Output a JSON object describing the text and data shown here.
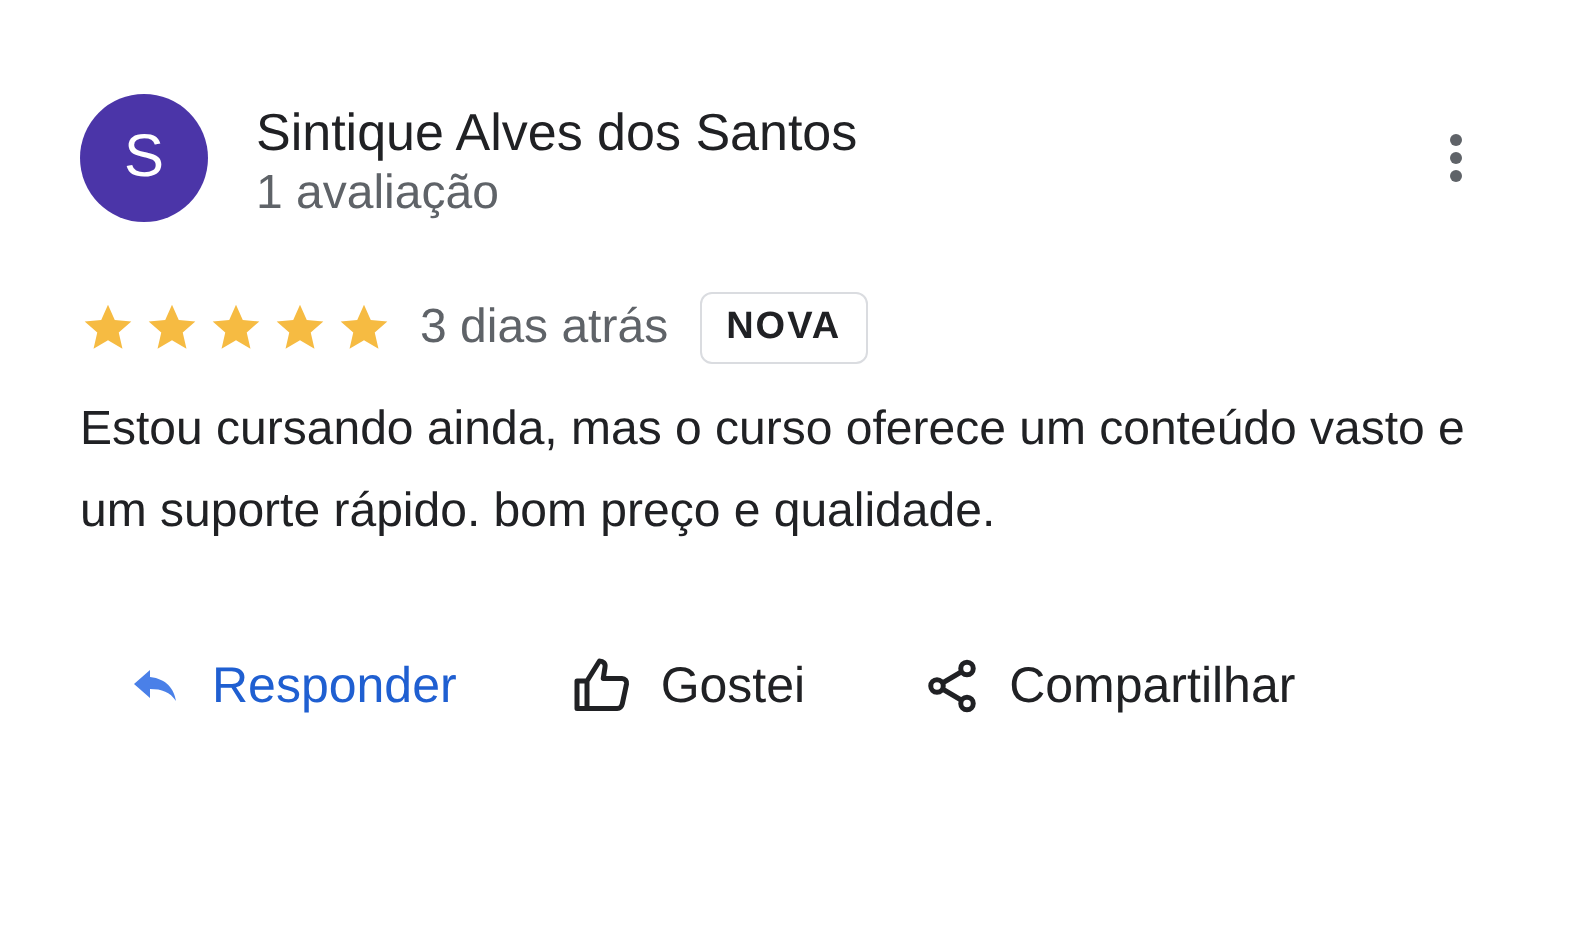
{
  "review": {
    "avatar": "S",
    "author": "Sintique Alves dos Santos",
    "review_count": "1 avaliação",
    "stars": 5,
    "time": "3 dias atrás",
    "badge": "NOVA",
    "text": "Estou cursando ainda, mas o curso oferece um conteúdo vasto e um suporte rápido. bom preço e qualidade."
  },
  "actions": [
    {
      "kind": "reply",
      "label": "Responder"
    },
    {
      "kind": "like",
      "label": "Gostei"
    },
    {
      "kind": "share",
      "label": "Compartilhar"
    }
  ]
}
